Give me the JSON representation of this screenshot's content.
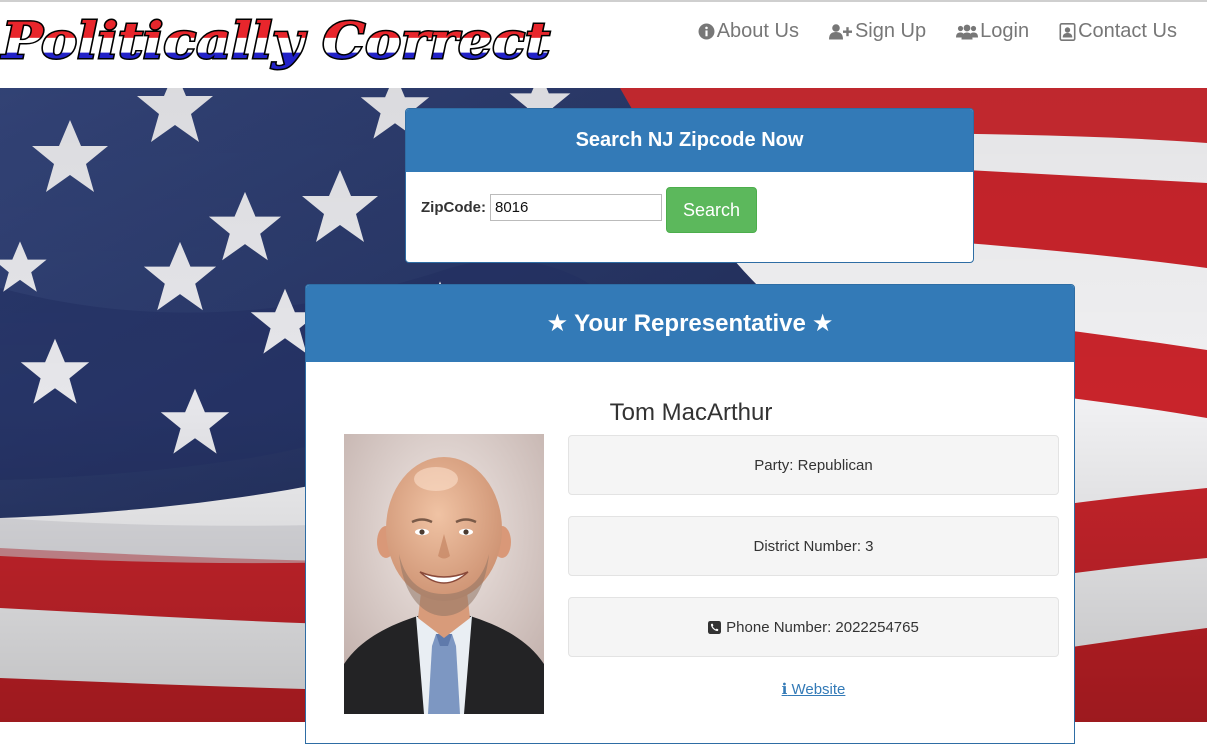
{
  "brand": {
    "logo_text": "Politically Correct"
  },
  "nav": {
    "items": [
      {
        "label": "About Us",
        "icon": "info-circle-icon"
      },
      {
        "label": "Sign Up",
        "icon": "user-plus-icon"
      },
      {
        "label": "Login",
        "icon": "users-icon"
      },
      {
        "label": "Contact Us",
        "icon": "contact-card-icon"
      }
    ]
  },
  "search": {
    "heading": "Search NJ Zipcode Now",
    "zip_label": "ZipCode:",
    "zip_value": "8016",
    "button_label": "Search"
  },
  "representative": {
    "heading": "Your Representative",
    "name": "Tom MacArthur",
    "party": "Party: Republican",
    "district": "District Number: 3",
    "phone": "Phone Number: 2022254765",
    "website_label": "Website"
  },
  "colors": {
    "primary": "#337ab7",
    "success": "#5cb85c",
    "nav_text": "#777777",
    "flag_red": "#c8242b",
    "flag_blue": "#2a3a6b"
  }
}
